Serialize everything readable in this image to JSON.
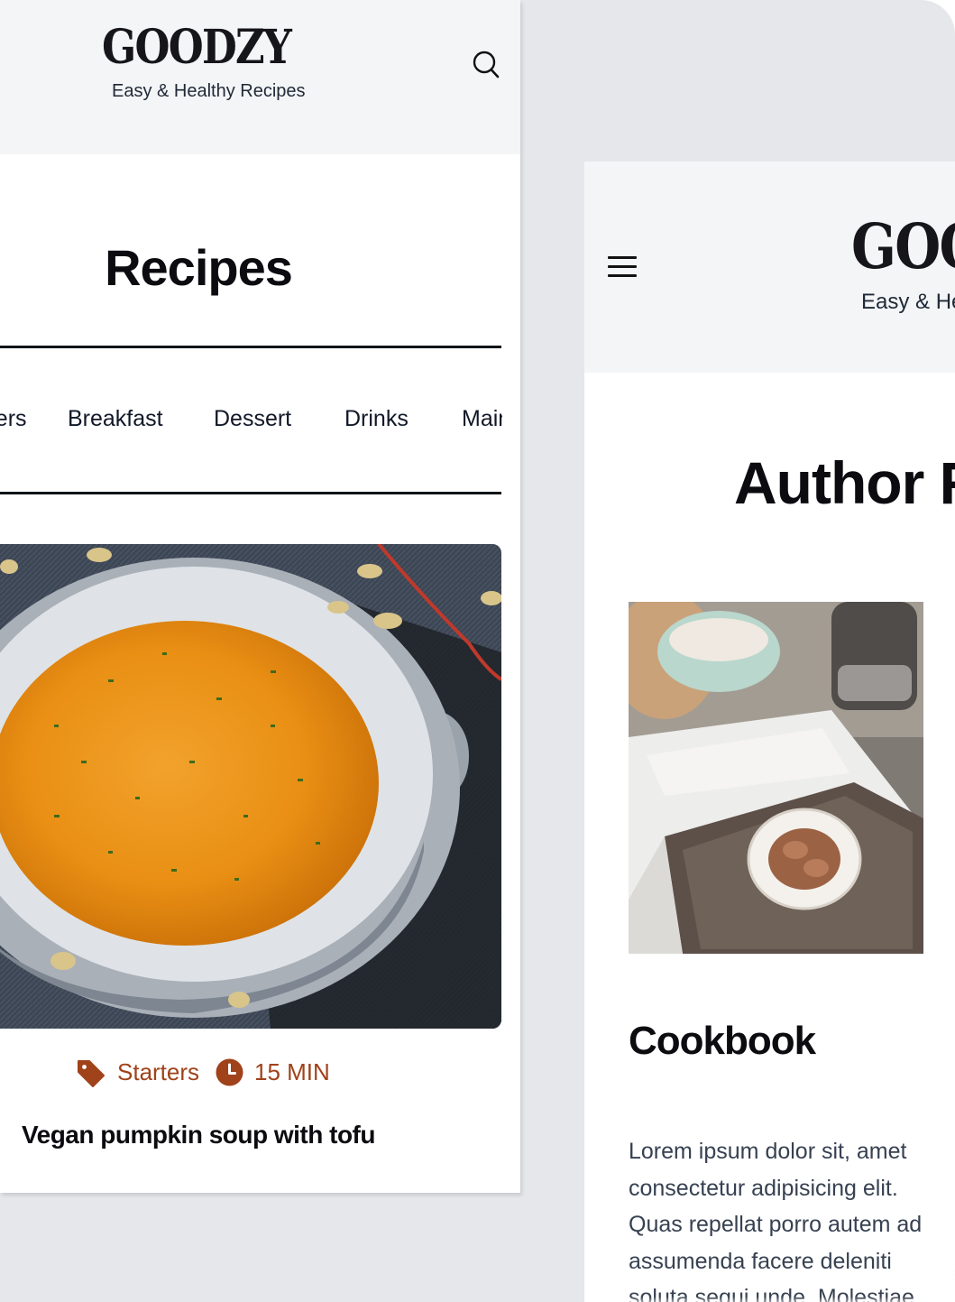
{
  "brand": {
    "name": "GOODZY",
    "tagline": "Easy & Healthy Recipes",
    "accent_color": "#a0421a"
  },
  "left_screen": {
    "header": {
      "search_icon": "search-icon"
    },
    "page_title": "Recipes",
    "category_tabs": [
      "Starters",
      "Breakfast",
      "Dessert",
      "Drinks",
      "Main"
    ],
    "recipe_card": {
      "image_alt": "Bowl of pumpkin soup topped with chives",
      "category": "Starters",
      "category_icon": "tag-icon",
      "duration": "15 MIN",
      "duration_icon": "clock-icon",
      "title": "Vegan pumpkin soup with tofu"
    }
  },
  "right_screen": {
    "header": {
      "menu_icon": "hamburger-menu-icon"
    },
    "page_title": "Author Recipes",
    "card": {
      "image_alt": "Open cookbook next to a bowl of flour",
      "heading": "Cookbook",
      "body": "Lorem ipsum dolor sit, amet consectetur adipisicing elit. Quas repellat porro autem ad assumenda facere deleniti soluta sequi unde. Molestiae"
    }
  }
}
